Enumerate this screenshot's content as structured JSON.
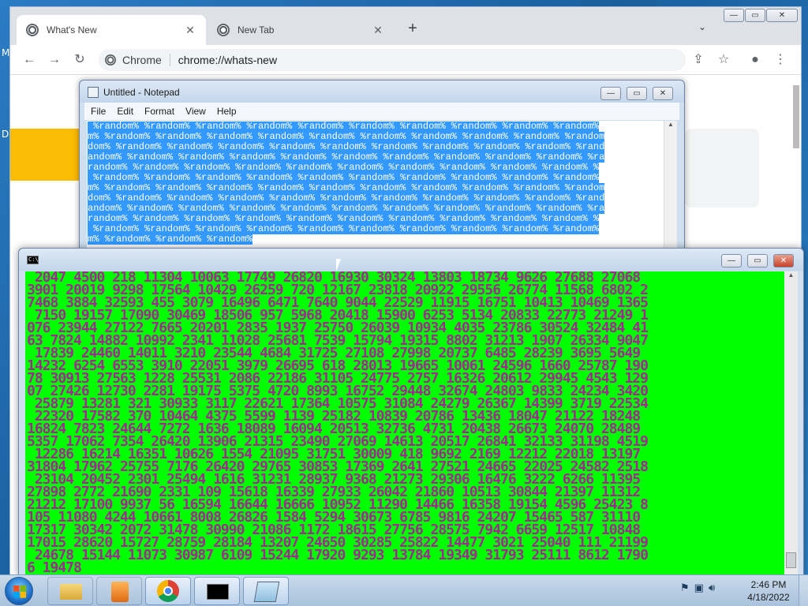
{
  "desktop": {
    "fragments": [
      "M",
      "D"
    ]
  },
  "chrome": {
    "tabs": [
      {
        "title": "What's New",
        "close": "✕"
      },
      {
        "title": "New Tab",
        "close": "✕"
      }
    ],
    "new_tab": "+",
    "tab_search": "⌄",
    "window_controls": {
      "minimize": "—",
      "maximize": "▭",
      "close": "✕"
    },
    "toolbar": {
      "back": "←",
      "forward": "→",
      "reload": "↻",
      "share": "⇪",
      "bookmark": "☆",
      "profile": "●",
      "menu": "⋮"
    },
    "omnibox": {
      "chip": "Chrome",
      "url": "chrome://whats-new"
    }
  },
  "notepad": {
    "title": "Untitled - Notepad",
    "menu": [
      "File",
      "Edit",
      "Format",
      "View",
      "Help"
    ],
    "lines": [
      " %random% %random% %random% %random% %random% %random% %random% %random% %random% %random%",
      "m% %random% %random% %random% %random% %random% %random% %random% %random% %random% %random",
      "dom% %random% %random% %random% %random% %random% %random% %random% %random% %random% %rand",
      "andom% %random% %random% %random% %random% %random% %random% %random% %random% %random% %ra",
      "random% %random% %random% %random% %random% %random% %random% %random% %random% %random% %",
      " %random% %random% %random% %random% %random% %random% %random% %random% %random% %random%",
      "m% %random% %random% %random% %random% %random% %random% %random% %random% %random% %random",
      "dom% %random% %random% %random% %random% %random% %random% %random% %random% %random% %rand",
      "andom% %random% %random% %random% %random% %random% %random% %random% %random% %random% %ra",
      "random% %random% %random% %random% %random% %random% %random% %random% %random% %random% %",
      " %random% %random% %random% %random% %random% %random% %random% %random% %random% %random%",
      "m% %random% %random% %random%"
    ],
    "window_controls": {
      "minimize": "—",
      "maximize": "▭",
      "close": "✕"
    }
  },
  "cmd": {
    "title_icon": "C:\\",
    "window_controls": {
      "minimize": "—",
      "maximize": "▭",
      "close": "✕"
    },
    "lines": [
      " 2047 4500 218 11304 10063 17749 26820 16930 30324 13803 18734 9626 27688 27068",
      "3901 20019 9298 17564 10429 26259 720 12167 23818 20922 29556 26774 11568 6802 2",
      "7468 3884 32593 455 3079 16496 6471 7640 9044 22529 11915 16751 10413 10469 1365",
      " 7150 19157 17090 30469 18506 957 5968 20418 15900 6253 5134 20833 22773 21249 1",
      "076 23944 27122 7665 20201 2835 1937 25750 26039 10934 4035 23786 30524 32484 41",
      "63 7824 14882 10992 2341 11028 25681 7539 15794 19315 8802 31213 1907 26334 9047",
      " 17839 24460 14011 3210 23544 4684 31725 27108 27998 20737 6485 28239 3695 5649",
      "14232 6254 6553 3910 22051 3979 26695 618 28013 19665 10061 24596 1660 25787 190",
      "78 30913 27563 1228 25531 2086 22186 31105 24775 2757 16326 20612 29945 4543 129",
      "07 27426 12730 2281 19175 5375 4720 8993 16752 29448 32674 24803 9833 24234 3420",
      " 25879 13281 321 30933 3117 22621 17364 10575 31084 24279 26367 14399 3719 22534",
      " 22320 17582 370 10464 4375 5599 1139 25182 10839 20786 13436 18047 21122 18248",
      "16824 7823 24644 7272 1636 18089 16094 20513 32736 4731 20438 26673 24070 28489",
      "5357 17062 7354 26420 13906 21315 23490 27069 14613 20517 26841 32133 31198 4519",
      " 12286 16214 16351 10626 1554 21095 31751 30009 418 9692 2169 12212 22018 13197",
      "31804 17962 25755 7176 26420 29765 30853 17369 2641 27521 24665 22025 24582 2518",
      " 23104 20452 2301 25494 1616 31231 28937 9368 21273 29306 16476 3222 6266 11395",
      "27898 2772 21690 2331 109 15618 16339 27933 26042 21860 10513 30844 21397 11312",
      "21212 17100 9937 56 16594 16644 16666 10952 11290 14466 16358 19154 4596 25423 8",
      "105 11080 4244 10661 8008 26826 1584 5294 30673 6785 9816 24207 15465 587 31110",
      "17317 30342 2072 31478 30990 21086 1172 18615 27756 28575 7942 6659 12517 10848",
      "17015 28620 15727 28759 28184 13207 24650 30285 25822 14477 3021 25040 111 21199",
      " 24678 15144 11073 30987 6109 15244 17920 9293 13784 19349 31793 25111 8612 1790",
      "6 19478"
    ]
  },
  "taskbar": {
    "clock_time": "2:46 PM",
    "clock_date": "4/18/2022",
    "tray_icons": [
      "flag-icon",
      "network-icon",
      "volume-icon"
    ]
  }
}
